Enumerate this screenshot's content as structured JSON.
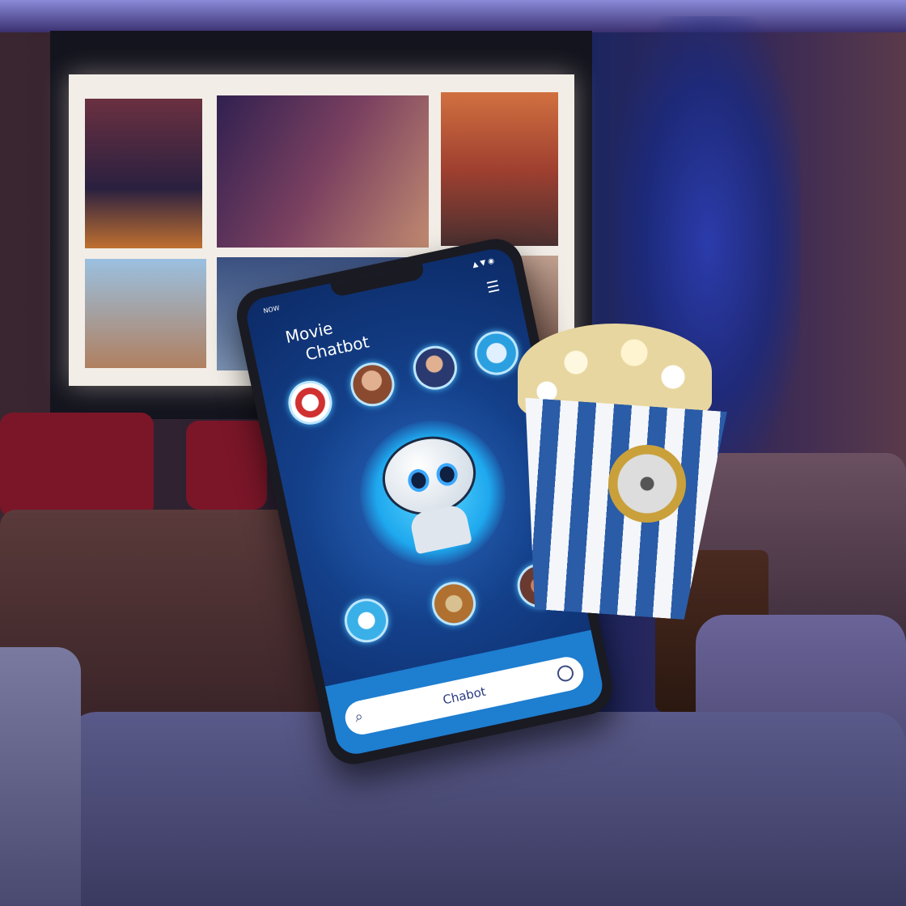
{
  "phone": {
    "status_left": "NOW",
    "status_right": "▲ ▼ ◉",
    "title_line1": "Movie",
    "title_line2": "Chatbot",
    "search_value": "Chabot"
  },
  "colors": {
    "accent": "#1e7ed0",
    "screen_bg": "#14408a",
    "popcorn_stripe": "#2a5ca8"
  }
}
